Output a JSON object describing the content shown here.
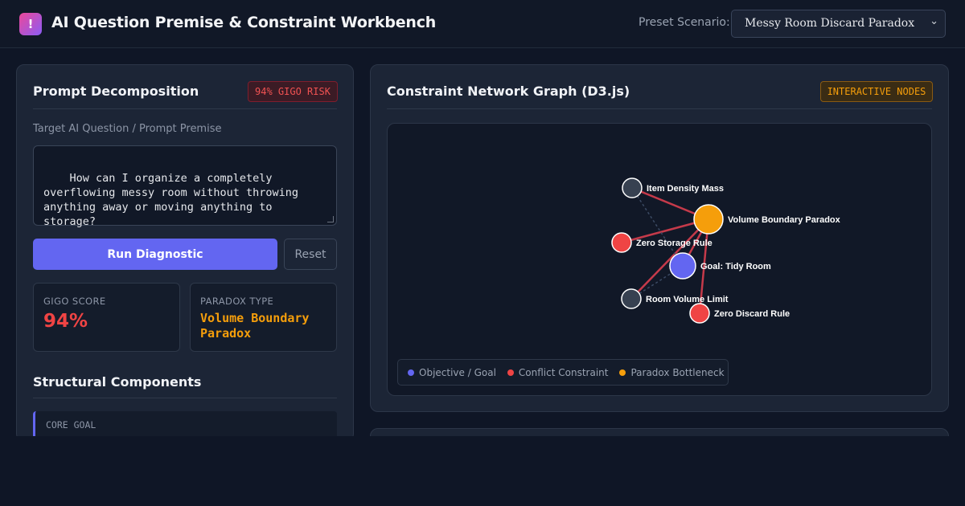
{
  "header": {
    "logo_glyph": "!",
    "title": "AI Question Premise & Constraint Workbench",
    "preset_label": "Preset Scenario:",
    "preset_selected": "Messy Room Discard Paradox"
  },
  "left_panel": {
    "title": "Prompt Decomposition",
    "risk_badge": "94% GIGO RISK",
    "field_label": "Target AI Question / Prompt Premise",
    "prompt_text": "How can I organize a completely\noverflowing messy room without throwing\nanything away or moving anything to\nstorage?",
    "run_button": "Run Diagnostic",
    "reset_button": "Reset",
    "gigo_label": "GIGO SCORE",
    "gigo_value": "94%",
    "paradox_label": "PARADOX TYPE",
    "paradox_value": "Volume Boundary Paradox",
    "components_title": "Structural Components",
    "first_component_label": "CORE GOAL"
  },
  "right_panel": {
    "title": "Constraint Network Graph (D3.js)",
    "badge": "INTERACTIVE NODES"
  },
  "graph": {
    "nodes": [
      {
        "id": "density",
        "label": "Item Density Mass",
        "kind": "neutral"
      },
      {
        "id": "paradox",
        "label": "Volume Boundary Paradox",
        "kind": "paradox"
      },
      {
        "id": "storage",
        "label": "Zero Storage Rule",
        "kind": "conflict"
      },
      {
        "id": "goal",
        "label": "Goal: Tidy Room",
        "kind": "goal"
      },
      {
        "id": "volume",
        "label": "Room Volume Limit",
        "kind": "neutral"
      },
      {
        "id": "discard",
        "label": "Zero Discard Rule",
        "kind": "conflict"
      }
    ],
    "legend": [
      {
        "label": "Objective / Goal",
        "color": "#6366f1"
      },
      {
        "label": "Conflict Constraint",
        "color": "#ef4444"
      },
      {
        "label": "Paradox Bottleneck",
        "color": "#f59e0b"
      }
    ],
    "colors": {
      "goal": "#6366f1",
      "conflict": "#ef4444",
      "paradox": "#f59e0b",
      "neutral": "#374151",
      "edge": "#c53a4a"
    }
  }
}
